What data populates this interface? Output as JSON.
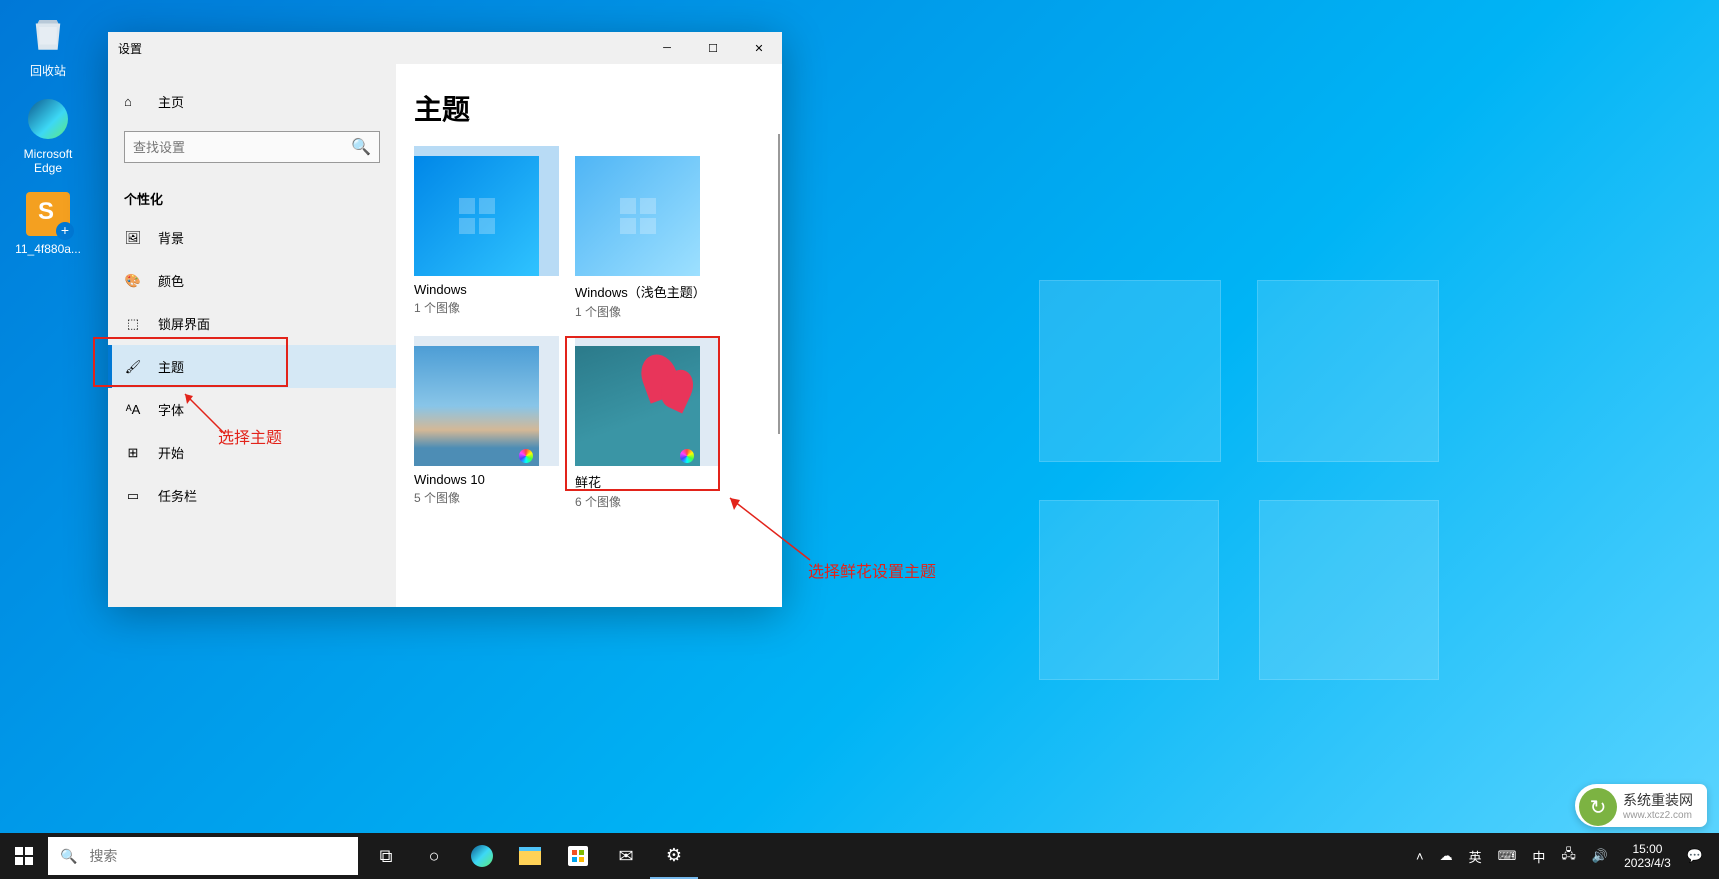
{
  "desktop_icons": {
    "recycle": "回收站",
    "edge": "Microsoft Edge",
    "file": "11_4f880a..."
  },
  "settings": {
    "title": "设置",
    "home": "主页",
    "search_placeholder": "查找设置",
    "section": "个性化",
    "nav": {
      "background": "背景",
      "colors": "颜色",
      "lockscreen": "锁屏界面",
      "themes": "主题",
      "fonts": "字体",
      "start": "开始",
      "taskbar": "任务栏"
    },
    "content_title": "主题",
    "themes": {
      "t1": {
        "name": "Windows",
        "sub": "1 个图像"
      },
      "t2": {
        "name": "Windows（浅色主题）",
        "sub": "1 个图像"
      },
      "t3": {
        "name": "Windows 10",
        "sub": "5 个图像"
      },
      "t4": {
        "name": "鲜花",
        "sub": "6 个图像"
      }
    }
  },
  "annotations": {
    "select_theme": "选择主题",
    "select_flower": "选择鲜花设置主题"
  },
  "taskbar": {
    "search": "搜索"
  },
  "tray": {
    "ime1": "英",
    "ime2": "中",
    "time": "15:00",
    "date": "2023/4/3"
  },
  "watermark": {
    "title": "系统重装网",
    "url": "www.xtcz2.com"
  }
}
